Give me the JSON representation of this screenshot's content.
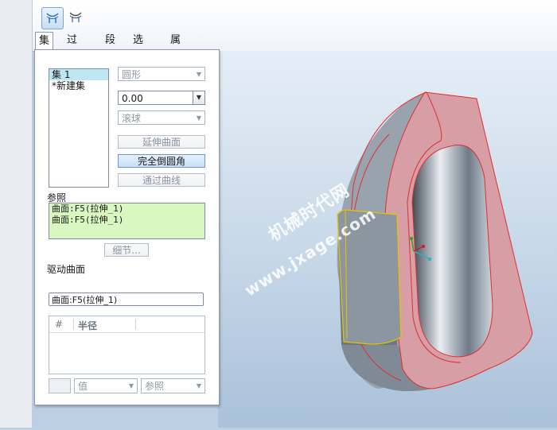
{
  "toolbar": {
    "icons": [
      "set-mode-icon",
      "transition-mode-icon"
    ]
  },
  "tabs": [
    "集",
    "过渡",
    "段",
    "选项",
    "属性"
  ],
  "sets": {
    "items": [
      "集 1",
      "*新建集"
    ],
    "selected_index": 0
  },
  "shape_select": {
    "value": "圆形"
  },
  "radius_input": {
    "value": "0.00"
  },
  "method_select": {
    "value": "滚球"
  },
  "buttons": {
    "extend_surface": "延伸曲面",
    "full_round": "完全倒圆角",
    "through_curve": "通过曲线",
    "details": "细节..."
  },
  "references": {
    "label": "参照",
    "items": [
      "曲面:F5(拉伸_1)",
      "曲面:F5(拉伸_1)"
    ]
  },
  "driving_surface": {
    "label": "驱动曲面",
    "value": "曲面:F5(拉伸_1)"
  },
  "radius_table": {
    "columns": [
      "#",
      "半径"
    ]
  },
  "bottom": {
    "value_select": "值",
    "reference_select": "参照"
  },
  "watermark": {
    "line1": "机械时代网",
    "line2": "www.jxage.com"
  },
  "colors": {
    "selection": "#bfe7f3",
    "reference_bg": "#d9f7c0",
    "model_red": "#e03030",
    "highlight_yellow": "#e8c400"
  }
}
